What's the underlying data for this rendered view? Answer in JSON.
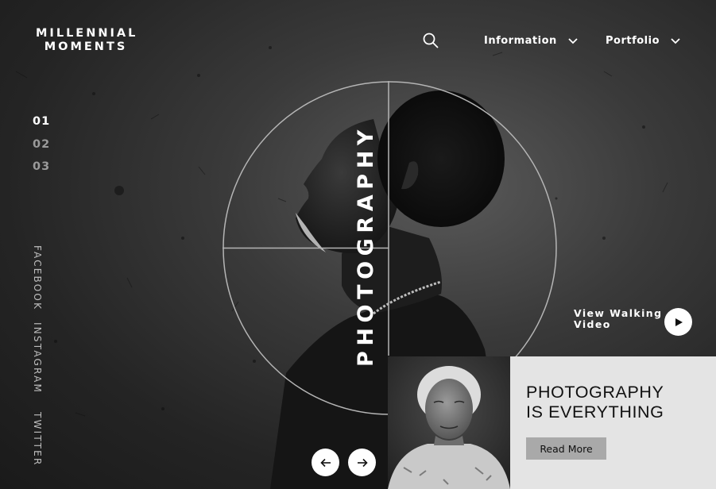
{
  "brand": {
    "line1": "MILLENNIAL",
    "line2": "MOMENTS"
  },
  "nav": {
    "search_icon": "search-icon",
    "items": [
      {
        "label": "Information",
        "icon": "chevron-down-icon"
      },
      {
        "label": "Portfolio",
        "icon": "chevron-down-icon"
      }
    ]
  },
  "slides": {
    "items": [
      "01",
      "02",
      "03"
    ],
    "active": "01"
  },
  "social": [
    "FACEBOOK",
    "INSTAGRAM",
    "TWITTER"
  ],
  "hero": {
    "vertical_title": "PHOTOGRAPHY"
  },
  "video": {
    "line1": "View Walking",
    "line2": "Video",
    "icon": "play-icon"
  },
  "carousel": {
    "prev_icon": "arrow-left-icon",
    "next_icon": "arrow-right-icon"
  },
  "card": {
    "title_line1": "PHOTOGRAPHY",
    "title_line2": "IS EVERYTHING",
    "button_label": "Read More"
  },
  "colors": {
    "background": "#2b2b2b",
    "card_bg": "#e4e4e4",
    "button_bg": "#a9a9a9",
    "text": "#ffffff"
  }
}
